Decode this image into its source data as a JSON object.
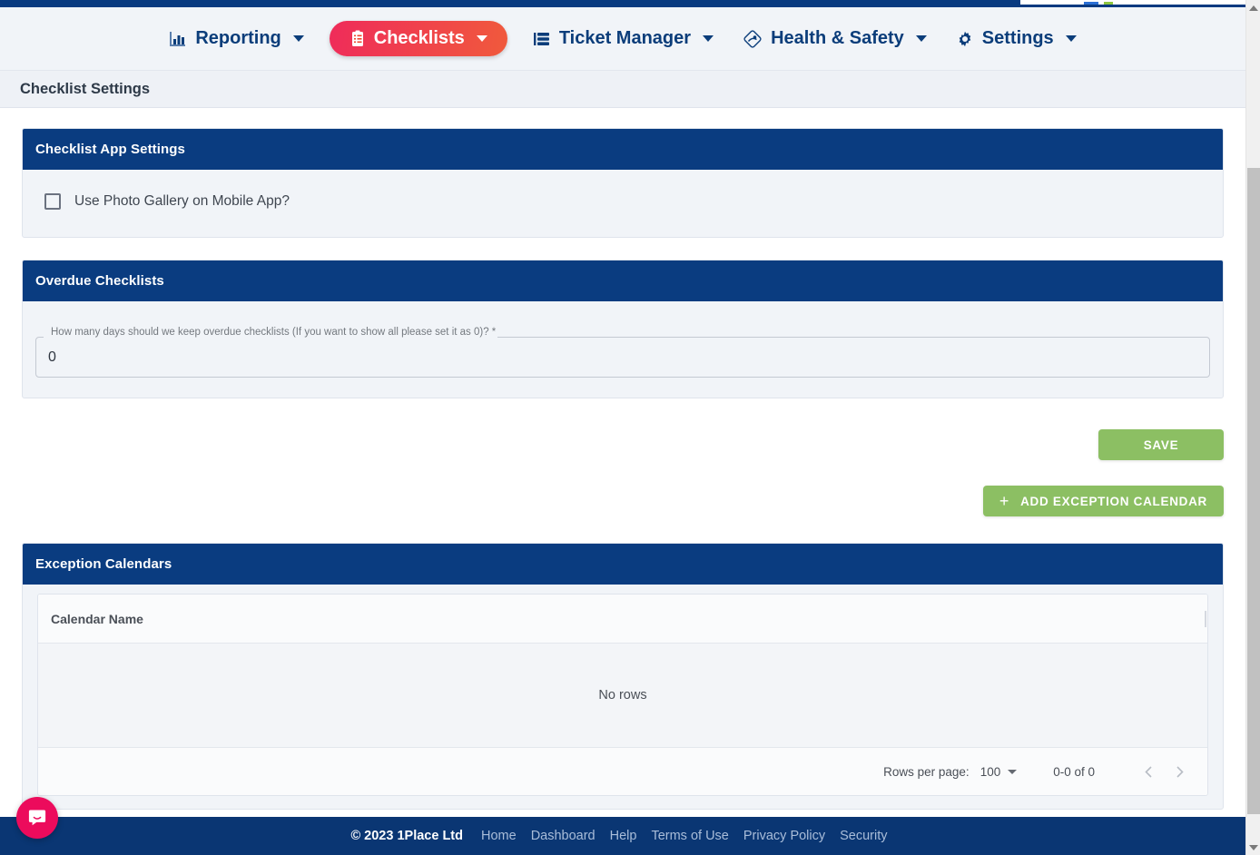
{
  "nav": {
    "items": [
      {
        "label": "Reporting",
        "icon": "bar-chart-icon",
        "active": false,
        "has_caret": true
      },
      {
        "label": "Checklists",
        "icon": "clipboard-icon",
        "active": true,
        "has_caret": true
      },
      {
        "label": "Ticket Manager",
        "icon": "stacked-list-icon",
        "active": false,
        "has_caret": true
      },
      {
        "label": "Health & Safety",
        "icon": "safety-diamond-icon",
        "active": false,
        "has_caret": true
      },
      {
        "label": "Settings",
        "icon": "gear-icon",
        "active": false,
        "has_caret": true
      }
    ],
    "active_color": "#ef2b5a",
    "text_color": "#0b3d7a"
  },
  "page": {
    "title": "Checklist Settings"
  },
  "app_settings_panel": {
    "header": "Checklist App Settings",
    "checkbox_label": "Use Photo Gallery on Mobile App?",
    "checkbox_checked": false
  },
  "overdue_panel": {
    "header": "Overdue Checklists",
    "field_label": "How many days should we keep overdue checklists (If you want to show all please set it as 0)? *",
    "field_value": "0",
    "field_placeholder": ""
  },
  "actions": {
    "save_label": "SAVE",
    "add_calendar_label": "ADD EXCEPTION CALENDAR",
    "add_calendar_icon": "plus-icon",
    "button_color": "#8cbf63"
  },
  "exception_calendars": {
    "header": "Exception Calendars",
    "columns": [
      "Calendar Name"
    ],
    "rows": [],
    "empty_message": "No rows",
    "pagination": {
      "rows_per_page_label": "Rows per page:",
      "rows_per_page_value": "100",
      "range_label": "0-0 of 0",
      "prev_icon": "chevron-left-icon",
      "next_icon": "chevron-right-icon"
    }
  },
  "footer": {
    "copyright": "©  2023 1Place Ltd",
    "links": [
      "Home",
      "Dashboard",
      "Help",
      "Terms of Use",
      "Privacy Policy",
      "Security"
    ],
    "background": "#0a3673"
  },
  "chat_widget": {
    "icon": "chat-bubble-icon",
    "color": "#ec0b5c"
  },
  "scrollbar": {
    "up_icon": "scroll-up-arrow-icon",
    "down_icon": "scroll-down-arrow-icon"
  }
}
